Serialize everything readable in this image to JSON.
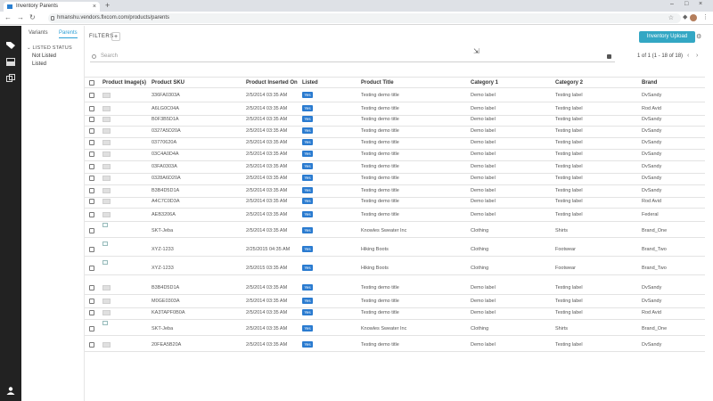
{
  "browser": {
    "tab_title": "Inventory Parents",
    "url": "hmanshu.vendors.flxcom.com/products/parents"
  },
  "sidebar": {
    "tabs": [
      {
        "label": "Variants"
      },
      {
        "label": "Parents"
      }
    ],
    "filter_group": "LISTED STATUS",
    "options": [
      {
        "label": "Not Listed"
      },
      {
        "label": "Listed"
      }
    ]
  },
  "toolbar": {
    "filters_label": "FILTERS",
    "add_label": "+",
    "upload_label": "Inventory Upload"
  },
  "search": {
    "placeholder": "Search"
  },
  "pagination": {
    "text": "1 of 1 (1 - 18 of 18)"
  },
  "table": {
    "headers": [
      "Product Image(s)",
      "Product SKU",
      "Product Inserted On",
      "Listed",
      "Product Title",
      "Category 1",
      "Category 2",
      "Brand"
    ],
    "rows": [
      {
        "sku": "336FA0303A",
        "inserted": "2/5/2014 03:35 AM",
        "listed": "Yes",
        "title": "Testing demo title",
        "cat1": "Demo label",
        "cat2": "Testing label",
        "brand": "DvSandy",
        "img": "ph"
      },
      {
        "sku": "A6LG0C04A",
        "inserted": "2/5/2014 03:35 AM",
        "listed": "Yes",
        "title": "Testing demo title",
        "cat1": "Demo label",
        "cat2": "Testing label",
        "brand": "Rod Avid",
        "img": "ph"
      },
      {
        "sku": "B0F3B5D1A",
        "inserted": "2/5/2014 03:35 AM",
        "listed": "Yes",
        "title": "Testing demo title",
        "cat1": "Demo label",
        "cat2": "Testing label",
        "brand": "DvSandy",
        "img": "ph"
      },
      {
        "sku": "0327A5D20A",
        "inserted": "2/5/2014 03:35 AM",
        "listed": "Yes",
        "title": "Testing demo title",
        "cat1": "Demo label",
        "cat2": "Testing label",
        "brand": "DvSandy",
        "img": "ph"
      },
      {
        "sku": "03770620A",
        "inserted": "2/5/2014 03:35 AM",
        "listed": "Yes",
        "title": "Testing demo title",
        "cat1": "Demo label",
        "cat2": "Testing label",
        "brand": "DvSandy",
        "img": "ph"
      },
      {
        "sku": "03C4A0D4A",
        "inserted": "2/5/2014 03:35 AM",
        "listed": "Yes",
        "title": "Testing demo title",
        "cat1": "Demo label",
        "cat2": "Testing label",
        "brand": "DvSandy",
        "img": "ph"
      },
      {
        "sku": "03FA0303A",
        "inserted": "2/5/2014 03:35 AM",
        "listed": "Yes",
        "title": "Testing demo title",
        "cat1": "Demo label",
        "cat2": "Testing label",
        "brand": "DvSandy",
        "img": "ph"
      },
      {
        "sku": "0328A6D20A",
        "inserted": "2/5/2014 03:35 AM",
        "listed": "Yes",
        "title": "Testing demo title",
        "cat1": "Demo label",
        "cat2": "Testing label",
        "brand": "DvSandy",
        "img": "ph"
      },
      {
        "sku": "B3B4D5D1A",
        "inserted": "2/5/2014 03:35 AM",
        "listed": "Yes",
        "title": "Testing demo title",
        "cat1": "Demo label",
        "cat2": "Testing label",
        "brand": "DvSandy",
        "img": "ph"
      },
      {
        "sku": "A4C7C0D3A",
        "inserted": "2/5/2014 03:35 AM",
        "listed": "Yes",
        "title": "Testing demo title",
        "cat1": "Demo label",
        "cat2": "Testing label",
        "brand": "Rod Avid",
        "img": "ph"
      },
      {
        "sku": "AEB3206A",
        "inserted": "2/5/2014 03:35 AM",
        "listed": "Yes",
        "title": "Testing demo title",
        "cat1": "Demo label",
        "cat2": "Testing label",
        "brand": "Federal",
        "img": "ph"
      },
      {
        "sku": "SKT-Jeba",
        "inserted": "2/5/2014 03:35 AM",
        "listed": "Yes",
        "title": "Knowles Sweater Inc",
        "cat1": "Clothing",
        "cat2": "Shirts",
        "brand": "Brand_One",
        "img": "broken"
      },
      {
        "sku": "XYZ-1233",
        "inserted": "2/25/2015 04:35 AM",
        "listed": "Yes",
        "title": "Hiking Boots",
        "cat1": "Clothing",
        "cat2": "Footwear",
        "brand": "Brand_Two",
        "img": "broken"
      },
      {
        "sku": "XYZ-1233",
        "inserted": "2/5/2015 03:35 AM",
        "listed": "Yes",
        "title": "Hiking Boots",
        "cat1": "Clothing",
        "cat2": "Footwear",
        "brand": "Brand_Two",
        "img": "broken"
      },
      {
        "sku": "B3B4D5D1A",
        "inserted": "2/5/2014 03:35 AM",
        "listed": "Yes",
        "title": "Testing demo title",
        "cat1": "Demo label",
        "cat2": "Testing label",
        "brand": "DvSandy",
        "img": "ph"
      },
      {
        "sku": "M0GE0303A",
        "inserted": "2/5/2014 03:35 AM",
        "listed": "Yes",
        "title": "Testing demo title",
        "cat1": "Demo label",
        "cat2": "Testing label",
        "brand": "DvSandy",
        "img": "ph"
      },
      {
        "sku": "KA3TAPF0B0A",
        "inserted": "2/5/2014 03:35 AM",
        "listed": "Yes",
        "title": "Testing demo title",
        "cat1": "Demo label",
        "cat2": "Testing label",
        "brand": "Rod Avid",
        "img": "ph"
      },
      {
        "sku": "SKT-Jeba",
        "inserted": "2/5/2014 03:35 AM",
        "listed": "Yes",
        "title": "Knowles Sweater Inc",
        "cat1": "Clothing",
        "cat2": "Shirts",
        "brand": "Brand_One",
        "img": "broken"
      },
      {
        "sku": "20FEA5B20A",
        "inserted": "2/5/2014 03:35 AM",
        "listed": "Yes",
        "title": "Testing demo title",
        "cat1": "Demo label",
        "cat2": "Testing label",
        "brand": "DvSandy",
        "img": "ph"
      }
    ]
  }
}
